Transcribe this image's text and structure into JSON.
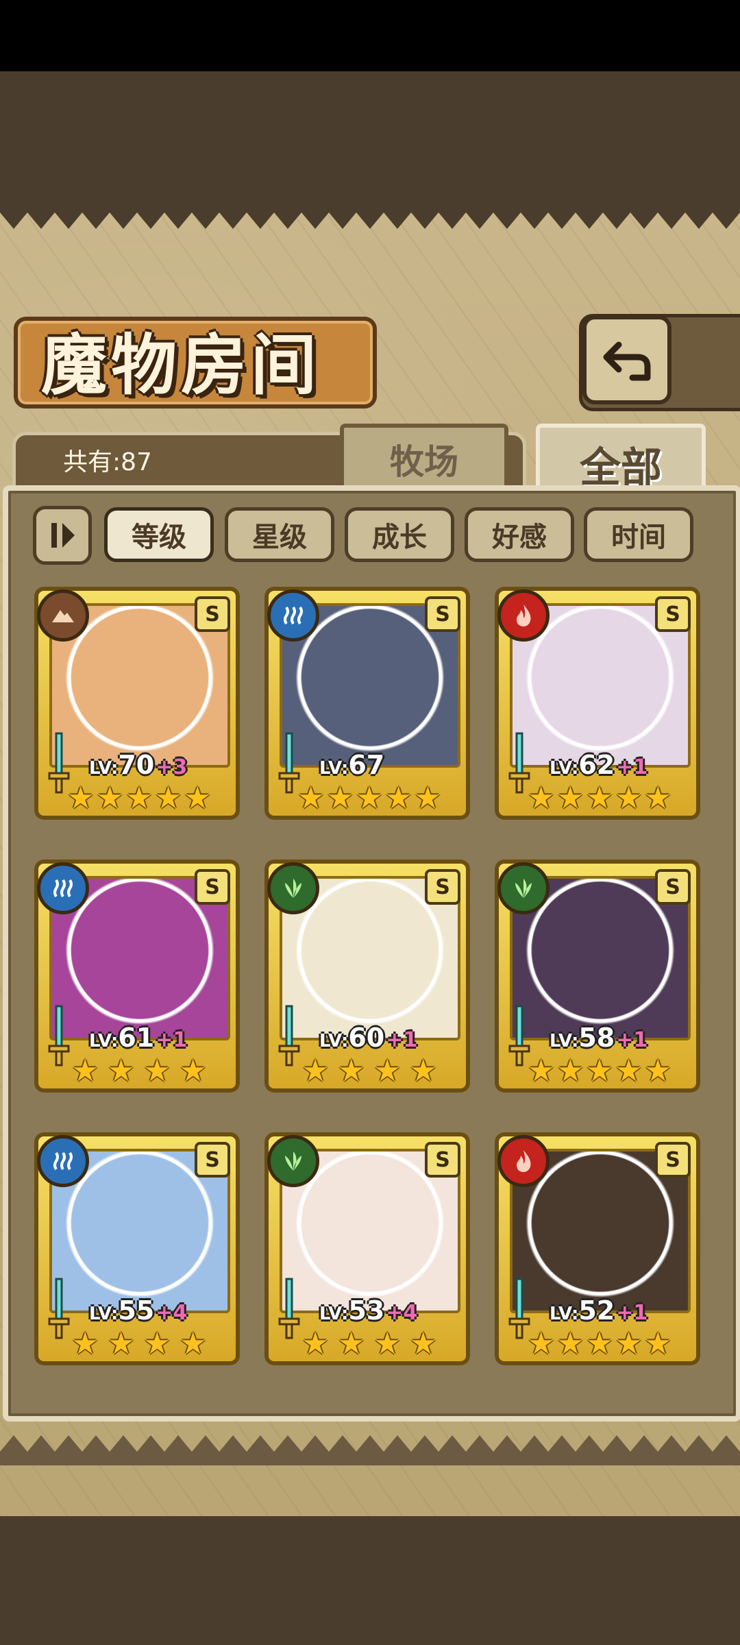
{
  "title": "魔物房间",
  "count_text": "共有:87",
  "tabs": {
    "farm": "牧场",
    "all": "全部",
    "active": "全部"
  },
  "sort_options": [
    "等级",
    "星级",
    "成长",
    "好感",
    "时间"
  ],
  "sort_active": "等级",
  "element_colors": {
    "earth": "#7a4b2c",
    "water": "#2a6fb6",
    "fire": "#c4231e",
    "nature": "#2f6b2c"
  },
  "cards": [
    {
      "level": "70",
      "bonus": "+3",
      "element": "earth",
      "element_icon": "earth-mountain-icon",
      "rank": "S",
      "stars": 5,
      "art_color": "#e9b27c"
    },
    {
      "level": "67",
      "bonus": "",
      "element": "water",
      "element_icon": "water-waves-icon",
      "rank": "S",
      "stars": 5,
      "art_color": "#56607a"
    },
    {
      "level": "62",
      "bonus": "+1",
      "element": "fire",
      "element_icon": "fire-flame-icon",
      "rank": "S",
      "stars": 5,
      "art_color": "#e6d7e6"
    },
    {
      "level": "61",
      "bonus": "+1",
      "element": "water",
      "element_icon": "water-waves-icon",
      "rank": "S",
      "stars": 4,
      "art_color": "#a6459a"
    },
    {
      "level": "60",
      "bonus": "+1",
      "element": "nature",
      "element_icon": "nature-leaf-icon",
      "rank": "S",
      "stars": 4,
      "art_color": "#efe7cf"
    },
    {
      "level": "58",
      "bonus": "+1",
      "element": "nature",
      "element_icon": "nature-leaf-icon",
      "rank": "S",
      "stars": 5,
      "art_color": "#4f3b57"
    },
    {
      "level": "55",
      "bonus": "+4",
      "element": "water",
      "element_icon": "water-waves-icon",
      "rank": "S",
      "stars": 4,
      "art_color": "#9fc0e6"
    },
    {
      "level": "53",
      "bonus": "+4",
      "element": "nature",
      "element_icon": "nature-leaf-icon",
      "rank": "S",
      "stars": 4,
      "art_color": "#f3e4dc"
    },
    {
      "level": "52",
      "bonus": "+1",
      "element": "fire",
      "element_icon": "fire-flame-icon",
      "rank": "S",
      "stars": 5,
      "art_color": "#4a3a2e"
    }
  ],
  "level_prefix": "LV:"
}
